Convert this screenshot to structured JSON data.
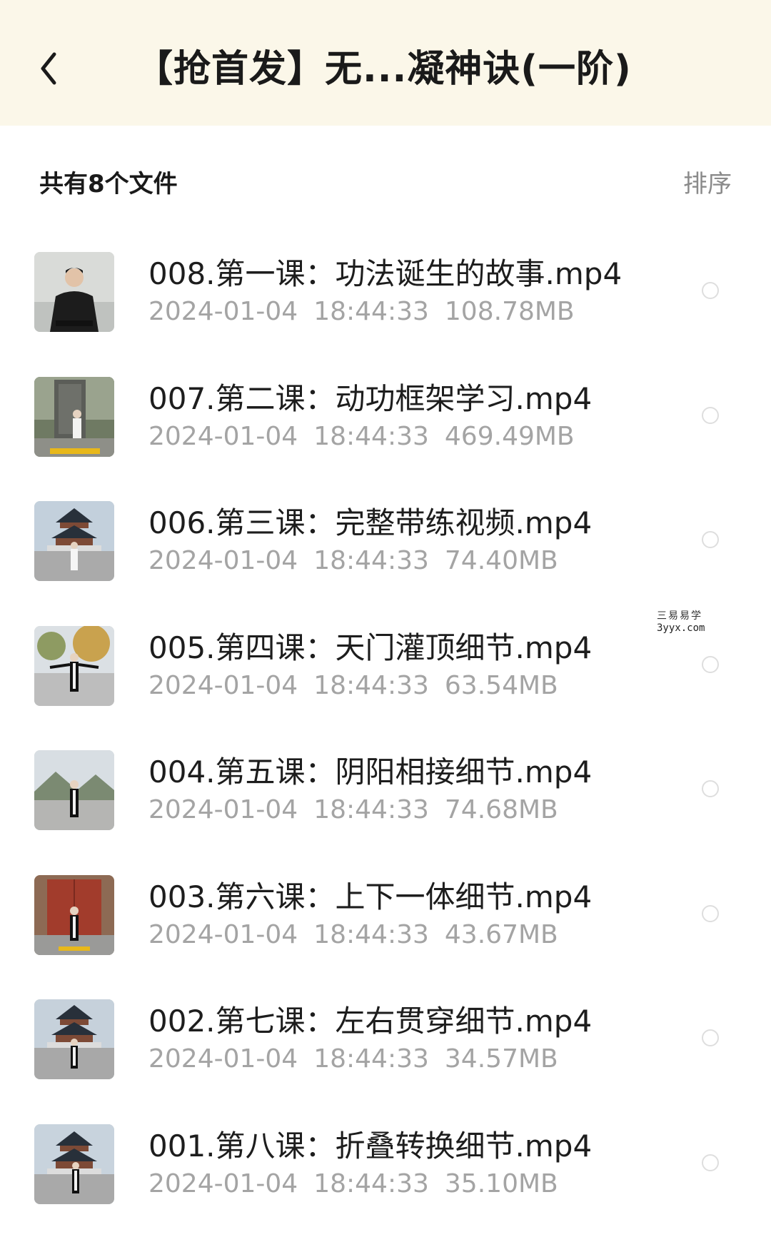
{
  "header": {
    "title": "【抢首发】无...凝神诀(一阶)",
    "back_icon": "chevron-left-icon",
    "background": "#fbf7e9"
  },
  "summary": {
    "file_count_label": "共有8个文件",
    "sort_label": "排序"
  },
  "files": [
    {
      "name": "008.第一课：功法诞生的故事.mp4",
      "date": "2024-01-04",
      "time": "18:44:33",
      "size": "108.78MB",
      "selected": false
    },
    {
      "name": "007.第二课：动功框架学习.mp4",
      "date": "2024-01-04",
      "time": "18:44:33",
      "size": "469.49MB",
      "selected": false
    },
    {
      "name": "006.第三课：完整带练视频.mp4",
      "date": "2024-01-04",
      "time": "18:44:33",
      "size": "74.40MB",
      "selected": false
    },
    {
      "name": "005.第四课：天门灌顶细节.mp4",
      "date": "2024-01-04",
      "time": "18:44:33",
      "size": "63.54MB",
      "selected": false
    },
    {
      "name": "004.第五课：阴阳相接细节.mp4",
      "date": "2024-01-04",
      "time": "18:44:33",
      "size": "74.68MB",
      "selected": false
    },
    {
      "name": "003.第六课：上下一体细节.mp4",
      "date": "2024-01-04",
      "time": "18:44:33",
      "size": "43.67MB",
      "selected": false
    },
    {
      "name": "002.第七课：左右贯穿细节.mp4",
      "date": "2024-01-04",
      "time": "18:44:33",
      "size": "34.57MB",
      "selected": false
    },
    {
      "name": "001.第八课：折叠转换细节.mp4",
      "date": "2024-01-04",
      "time": "18:44:33",
      "size": "35.10MB",
      "selected": false
    }
  ],
  "watermark": {
    "chinese": "三易易学",
    "domain": "3yyx.com"
  },
  "colors": {
    "meta_text": "#a4a4a4",
    "sort_text": "#8a8a8a",
    "radio_border": "#dedede"
  }
}
